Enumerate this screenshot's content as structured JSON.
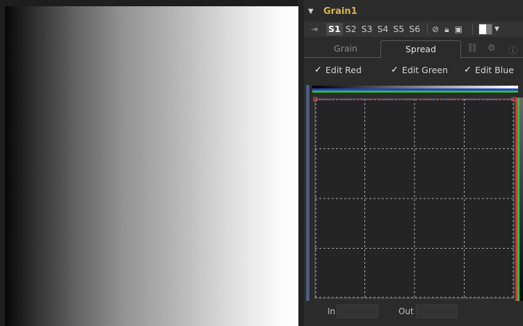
{
  "node": {
    "title": "Grain1"
  },
  "versions": {
    "items": [
      "S1",
      "S2",
      "S3",
      "S4",
      "S5",
      "S6"
    ],
    "active": "S1"
  },
  "tabs": {
    "items": [
      "Grain",
      "Spread"
    ],
    "active": "Spread"
  },
  "checkboxes": [
    {
      "label": "Edit Red",
      "checked": true
    },
    {
      "label": "Edit Green",
      "checked": true
    },
    {
      "label": "Edit Blue",
      "checked": true
    }
  ],
  "curve_editor": {
    "in_label": "In",
    "out_label": "Out",
    "in_value": "",
    "out_value": ""
  },
  "icons": {
    "collapse": "chevron-down-icon",
    "pin": "pin-icon",
    "disable": "disable-icon",
    "lock": "lock-icon",
    "save": "save-icon",
    "swatch": "color-swatch-icon",
    "link": "link-icon",
    "settings": "gear-icon",
    "info": "info-icon"
  },
  "colors": {
    "node_title": "#d8b44a",
    "curve_red": "#e64a4a",
    "curve_green": "#3fd14a",
    "curve_blue": "#3f6fe6"
  }
}
